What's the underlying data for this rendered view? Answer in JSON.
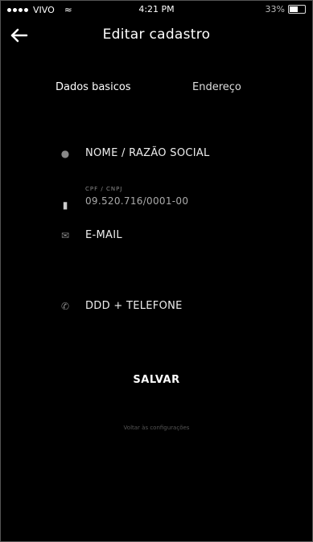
{
  "status_bar": {
    "carrier": "VIVO",
    "time": "4:21 PM",
    "battery": "33%"
  },
  "header": {
    "title": "Editar cadastro"
  },
  "tabs": [
    {
      "label": "Dados basicos",
      "active": true
    },
    {
      "label": "Endereço",
      "active": false
    }
  ],
  "form": {
    "name_label": "NOME / RAZÃO SOCIAL",
    "document_small_label": "CPF / CNPJ",
    "document_value": "09.520.716/0001-00",
    "email_label": "E-MAIL",
    "phone_label": "DDD + TELEFONE"
  },
  "actions": {
    "save_label": "SALVAR",
    "footer_link": "Voltar às configurações"
  },
  "colors": {
    "background": "#000000",
    "text": "#ffffff",
    "muted": "#888888"
  }
}
